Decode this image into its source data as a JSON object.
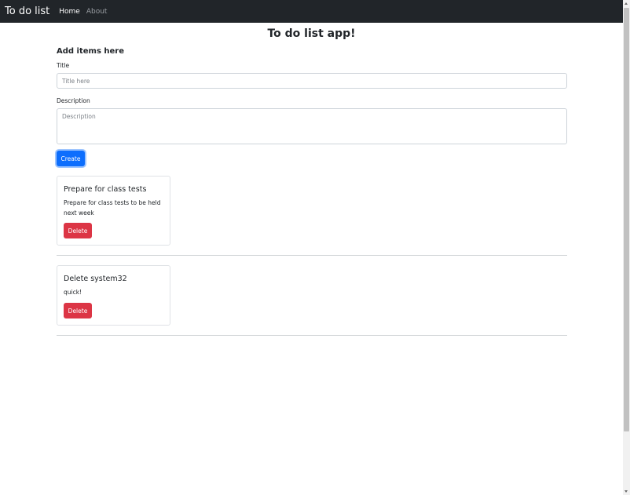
{
  "navbar": {
    "brand": "To do list",
    "links": [
      {
        "label": "Home",
        "active": true
      },
      {
        "label": "About",
        "active": false
      }
    ]
  },
  "page": {
    "title": "To do list app!"
  },
  "form": {
    "heading": "Add items here",
    "title_label": "Title",
    "title_placeholder": "Title here",
    "title_value": "",
    "description_label": "Description",
    "description_placeholder": "Description",
    "description_value": "",
    "create_label": "Create"
  },
  "todos": [
    {
      "title": "Prepare for class tests",
      "description": "Prepare for class tests to be held next week",
      "delete_label": "Delete"
    },
    {
      "title": "Delete system32",
      "description": "quick!",
      "delete_label": "Delete"
    }
  ],
  "colors": {
    "navbar_bg": "#212529",
    "primary": "#0d6efd",
    "danger": "#dc3545"
  }
}
